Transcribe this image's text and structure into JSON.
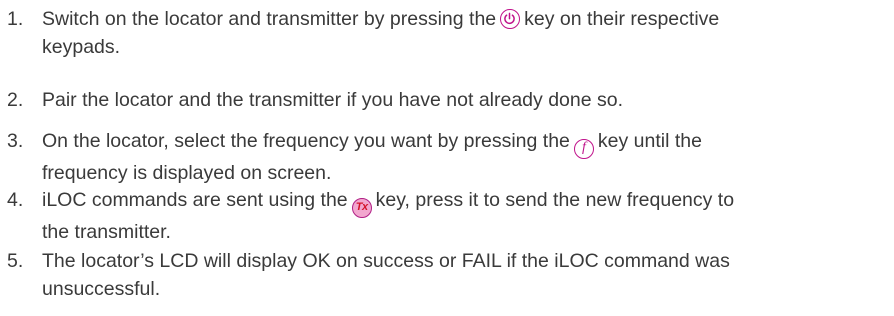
{
  "steps": [
    {
      "number": "1.",
      "before": "Switch on the locator and transmitter by pressing the",
      "icon": "power-icon",
      "after": "key on their respective",
      "line2": "keypads."
    },
    {
      "number": "2.",
      "text": "Pair the locator and the transmitter if you have not already done so."
    },
    {
      "number": "3.",
      "before": "On the locator, select the frequency you want by pressing the",
      "icon": "frequency-f-icon",
      "icon_text": "f",
      "after": "key until the",
      "line2": "frequency is displayed on screen."
    },
    {
      "number": "4.",
      "before": "iLOC commands are sent using the",
      "icon": "tx-key-icon",
      "icon_text": "Tx",
      "after": "key, press it to send the new frequency to",
      "line2": "the transmitter."
    },
    {
      "number": "5.",
      "line1": "The locator’s LCD will display OK on success or FAIL if the iLOC command was",
      "line2": "unsuccessful."
    }
  ],
  "colors": {
    "text": "#3a3a3a",
    "icon_accent": "#c0138b",
    "tx_fill": "#f2a7cf",
    "tx_text": "#d4132b"
  }
}
